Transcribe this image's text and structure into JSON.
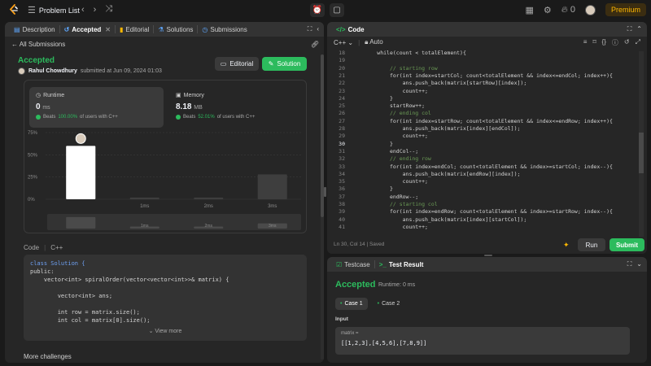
{
  "topbar": {
    "problem_list": "Problem List",
    "streak": "0",
    "premium": "Premium"
  },
  "left_tabs": [
    {
      "label": "Description",
      "icon": "document-icon"
    },
    {
      "label": "Accepted",
      "icon": "history-icon"
    },
    {
      "label": "Editorial",
      "icon": "book-icon"
    },
    {
      "label": "Solutions",
      "icon": "flask-icon"
    },
    {
      "label": "Submissions",
      "icon": "clock-icon"
    }
  ],
  "submission": {
    "back_label": "All Submissions",
    "status": "Accepted",
    "author": "Rahul Chowdhury",
    "submitted_at": "submitted at Jun 09, 2024 01:03",
    "editorial_btn": "Editorial",
    "solution_btn": "Solution"
  },
  "runtime": {
    "label": "Runtime",
    "value": "0",
    "unit": "ms",
    "beats_pre": "Beats",
    "beats_pct": "100.00%",
    "beats_post": "of users with C++"
  },
  "memory": {
    "label": "Memory",
    "value": "8.18",
    "unit": "MB",
    "beats_pre": "Beats",
    "beats_pct": "52.01%",
    "beats_post": "of users with C++"
  },
  "chart_data": {
    "type": "bar",
    "categories": [
      "0ms",
      "1ms",
      "2ms",
      "3ms"
    ],
    "values": [
      60,
      2,
      2,
      28
    ],
    "x_tick_labels": [
      "",
      "1ms",
      "2ms",
      "3ms"
    ],
    "y_ticks": [
      "75%",
      "50%",
      "25%",
      "0%"
    ],
    "ylim": [
      0,
      75
    ],
    "highlight_index": 0,
    "mini_values": [
      22,
      4,
      4,
      10
    ],
    "mini_labels": [
      "",
      "1ms",
      "2ms",
      "3ms"
    ],
    "colors": {
      "highlight": "#ffffff",
      "bar": "#3e3e3e",
      "grid": "#3a3a3a"
    }
  },
  "code_section": {
    "label": "Code",
    "lang": "C++",
    "lines": [
      "class Solution {",
      "public:",
      "    vector<int> spiralOrder(vector<vector<int>>& matrix) {",
      "",
      "        vector<int> ans;",
      "",
      "        int row = matrix.size();",
      "        int col = matrix[0].size();"
    ],
    "view_more": "View more"
  },
  "more_challenges": "More challenges",
  "code_panel": {
    "title": "Code",
    "lang": "C++",
    "mode": "Auto",
    "status": "Ln 30, Col 14  |  Saved",
    "run": "Run",
    "submit": "Submit",
    "lines": [
      {
        "n": "18",
        "t": "        while(count < totalElement){"
      },
      {
        "n": "19",
        "t": ""
      },
      {
        "n": "20",
        "t": "            // starting row"
      },
      {
        "n": "21",
        "t": "            for(int index=startCol; count<totalElement && index<=endCol; index++){"
      },
      {
        "n": "22",
        "t": "                ans.push_back(matrix[startRow][index]);"
      },
      {
        "n": "23",
        "t": "                count++;"
      },
      {
        "n": "24",
        "t": "            }"
      },
      {
        "n": "25",
        "t": "            startRow++;"
      },
      {
        "n": "26",
        "t": "            // ending col"
      },
      {
        "n": "27",
        "t": "            for(int index=startRow; count<totalElement && index<=endRow; index++){"
      },
      {
        "n": "28",
        "t": "                ans.push_back(matrix[index][endCol]);"
      },
      {
        "n": "29",
        "t": "                count++;"
      },
      {
        "n": "30",
        "t": "            }"
      },
      {
        "n": "31",
        "t": "            endCol--;"
      },
      {
        "n": "32",
        "t": "            // ending row"
      },
      {
        "n": "33",
        "t": "            for(int index=endCol; count<totalElement && index>=startCol; index--){"
      },
      {
        "n": "34",
        "t": "                ans.push_back(matrix[endRow][index]);"
      },
      {
        "n": "35",
        "t": "                count++;"
      },
      {
        "n": "36",
        "t": "            }"
      },
      {
        "n": "37",
        "t": "            endRow--;"
      },
      {
        "n": "38",
        "t": "            // starting col"
      },
      {
        "n": "39",
        "t": "            for(int index=endRow; count<totalElement && index>=startRow; index--){"
      },
      {
        "n": "40",
        "t": "                ans.push_back(matrix[index][startCol]);"
      },
      {
        "n": "41",
        "t": "                count++;"
      }
    ]
  },
  "test_panel": {
    "tab_testcase": "Testcase",
    "tab_result": "Test Result",
    "status": "Accepted",
    "runtime": "Runtime: 0 ms",
    "case1": "Case 1",
    "case2": "Case 2",
    "input_label": "Input",
    "var_name": "matrix =",
    "var_value": "[[1,2,3],[4,5,6],[7,8,9]]"
  }
}
